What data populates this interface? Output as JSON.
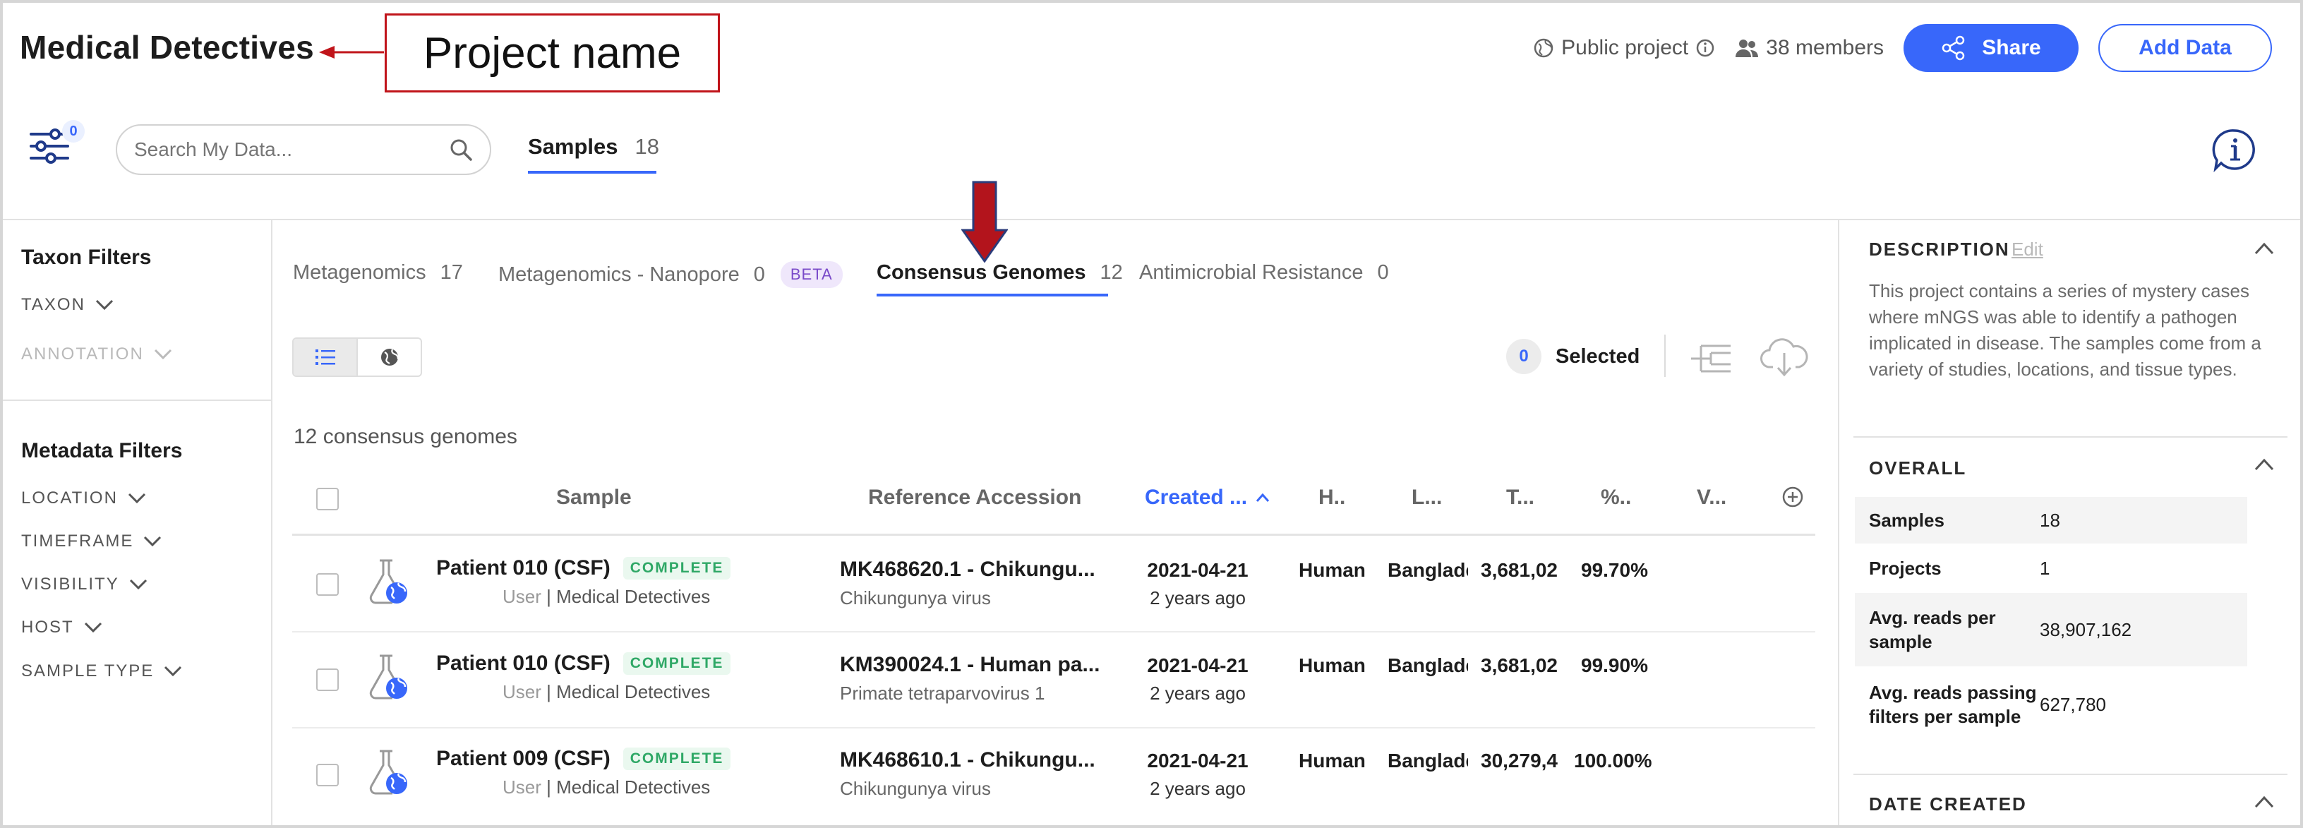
{
  "project": {
    "name": "Medical Detectives"
  },
  "annotation": {
    "label": "Project name"
  },
  "header": {
    "visibility": "Public project",
    "members": "38 members",
    "share_label": "Share",
    "add_data_label": "Add Data"
  },
  "toolbar": {
    "filter_count": "0",
    "search_placeholder": "Search My Data...",
    "tab_label": "Samples",
    "tab_count": "18"
  },
  "sidebar": {
    "taxon_title": "Taxon Filters",
    "taxon_items": [
      "TAXON",
      "ANNOTATION"
    ],
    "metadata_title": "Metadata Filters",
    "metadata_items": [
      "LOCATION",
      "TIMEFRAME",
      "VISIBILITY",
      "HOST",
      "SAMPLE TYPE"
    ]
  },
  "subtabs": [
    {
      "label": "Metagenomics",
      "count": "17"
    },
    {
      "label": "Metagenomics - Nanopore",
      "count": "0",
      "badge": "BETA"
    },
    {
      "label": "Consensus Genomes",
      "count": "12"
    },
    {
      "label": "Antimicrobial Resistance",
      "count": "0"
    }
  ],
  "selection": {
    "count": "0",
    "label": "Selected"
  },
  "results": {
    "summary": "12 consensus genomes"
  },
  "table": {
    "headers": [
      "Sample",
      "Reference Accession",
      "Created ...",
      "H..",
      "L...",
      "T...",
      "%..",
      "V..."
    ],
    "rows": [
      {
        "name": "Patient 010 (CSF)",
        "status": "COMPLETE",
        "user": "User",
        "project": "Medical Detectives",
        "accession": "MK468620.1 - Chikungu...",
        "organism": "Chikungunya virus",
        "date": "2021-04-21",
        "ago": "2 years ago",
        "host": "Human",
        "location": "Banglade",
        "total": "3,681,02",
        "pct": "99.70%"
      },
      {
        "name": "Patient 010 (CSF)",
        "status": "COMPLETE",
        "user": "User",
        "project": "Medical Detectives",
        "accession": "KM390024.1 - Human pa...",
        "organism": "Primate tetraparvovirus 1",
        "date": "2021-04-21",
        "ago": "2 years ago",
        "host": "Human",
        "location": "Banglade",
        "total": "3,681,02",
        "pct": "99.90%"
      },
      {
        "name": "Patient 009 (CSF)",
        "status": "COMPLETE",
        "user": "User",
        "project": "Medical Detectives",
        "accession": "MK468610.1 - Chikungu...",
        "organism": "Chikungunya virus",
        "date": "2021-04-21",
        "ago": "2 years ago",
        "host": "Human",
        "location": "Banglade",
        "total": "30,279,4",
        "pct": "100.00%"
      }
    ]
  },
  "panel": {
    "description_title": "DESCRIPTION",
    "edit_label": "Edit",
    "description": "This project contains a series of mystery cases where mNGS was able to identify a pathogen implicated in disease. The samples come from a variety of studies, locations, and tissue types.",
    "overall_title": "OVERALL",
    "stats": [
      {
        "key": "Samples",
        "value": "18"
      },
      {
        "key": "Projects",
        "value": "1"
      },
      {
        "key": "Avg. reads per sample",
        "value": "38,907,162"
      },
      {
        "key": "Avg. reads passing filters per sample",
        "value": "627,780"
      }
    ],
    "date_title": "DATE CREATED"
  },
  "colors": {
    "accent": "#3867fa",
    "annotation": "#c0141a",
    "complete": "#2fa866"
  }
}
